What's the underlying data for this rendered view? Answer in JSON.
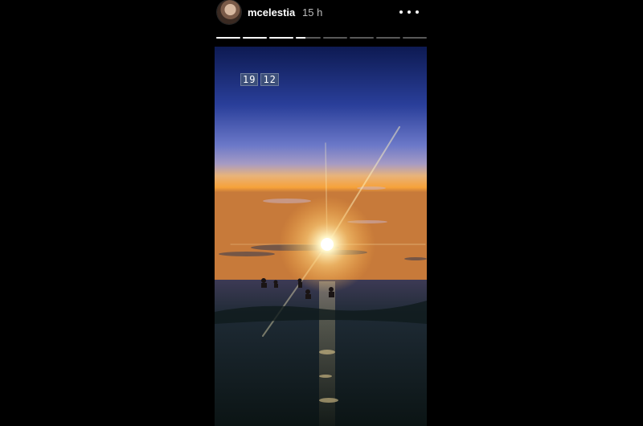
{
  "story": {
    "username": "mcelestia",
    "time_ago": "15 h",
    "avatar_icon": "avatar-photo",
    "more_icon": "more-horizontal-icon",
    "progress": {
      "segments": 8,
      "completed": 3,
      "current_fraction": 0.4
    }
  },
  "photo": {
    "scene": "sunset-over-sea",
    "timestamp_hours": "19",
    "timestamp_minutes": "12"
  },
  "colors": {
    "background": "#000000",
    "text": "#ffffff",
    "muted": "#bdbdbd"
  }
}
